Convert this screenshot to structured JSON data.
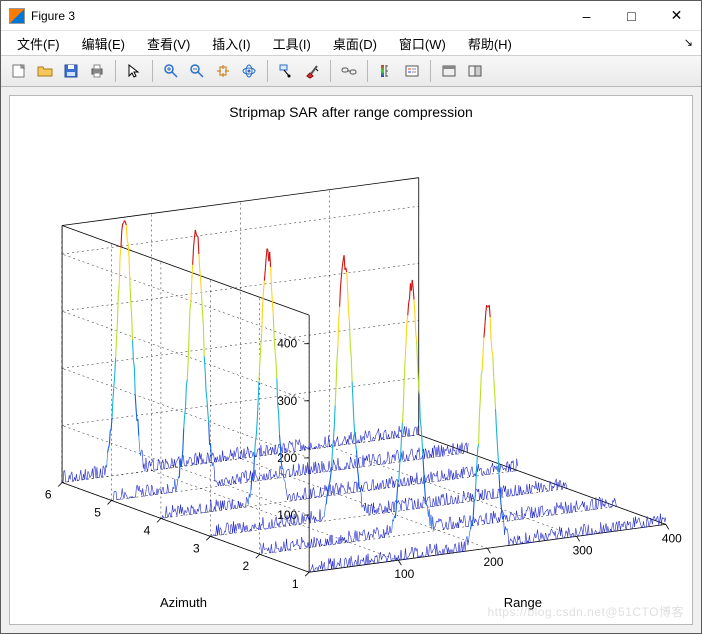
{
  "window": {
    "title": "Figure 3",
    "minimize": "–",
    "maximize": "□",
    "close": "✕"
  },
  "menu": {
    "items": [
      "文件(F)",
      "编辑(E)",
      "查看(V)",
      "插入(I)",
      "工具(I)",
      "桌面(D)",
      "窗口(W)",
      "帮助(H)"
    ]
  },
  "toolbar": {
    "icons": [
      "new-figure-icon",
      "open-icon",
      "save-icon",
      "print-icon",
      "sep",
      "pointer-icon",
      "sep",
      "zoom-in-icon",
      "zoom-out-icon",
      "pan-icon",
      "rotate3d-icon",
      "sep",
      "data-cursor-icon",
      "brush-icon",
      "sep",
      "link-icon",
      "sep",
      "colorbar-icon",
      "legend-icon",
      "sep",
      "hide-tools-icon",
      "dock-icon"
    ]
  },
  "chart_data": {
    "type": "line",
    "title": "Stripmap SAR after range compression",
    "xlabel": "Range",
    "ylabel": "Azimuth",
    "zlabel": "",
    "x_range": [
      1,
      400
    ],
    "y_range": [
      1,
      6
    ],
    "z_range": [
      0,
      450
    ],
    "x_ticks": [
      100,
      200,
      300,
      400
    ],
    "y_ticks": [
      1,
      2,
      3,
      4,
      5,
      6
    ],
    "z_ticks": [
      100,
      200,
      300,
      400
    ],
    "series": [
      {
        "azimuth": 1,
        "peak_range": 200,
        "peak_amplitude": 420
      },
      {
        "azimuth": 2,
        "peak_range": 170,
        "peak_amplitude": 430
      },
      {
        "azimuth": 3,
        "peak_range": 150,
        "peak_amplitude": 440
      },
      {
        "azimuth": 4,
        "peak_range": 120,
        "peak_amplitude": 435
      },
      {
        "azimuth": 5,
        "peak_range": 95,
        "peak_amplitude": 440
      },
      {
        "azimuth": 6,
        "peak_range": 70,
        "peak_amplitude": 445
      }
    ],
    "baseline_noise_amplitude": 15
  },
  "watermark": "https://blog.csdn.net@51CTO博客"
}
